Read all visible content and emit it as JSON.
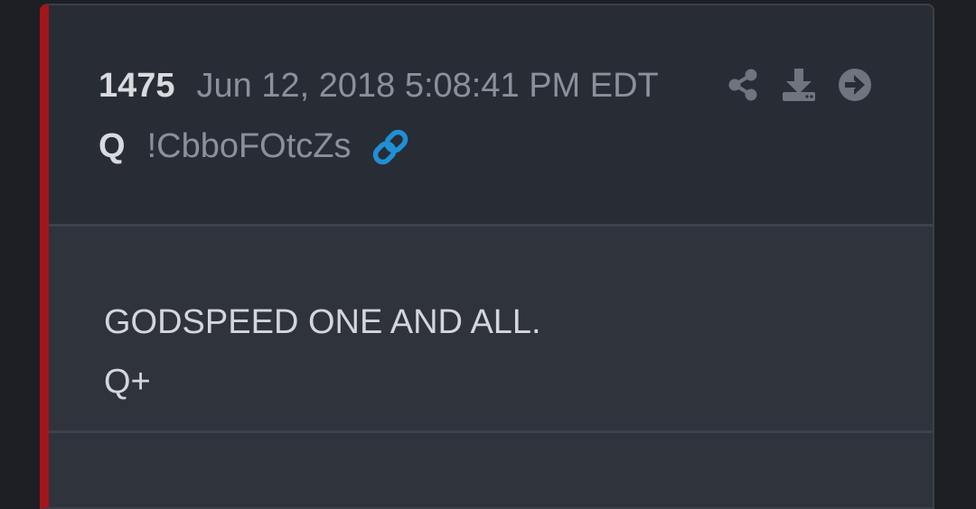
{
  "post": {
    "number": "1475",
    "date": "Jun 12, 2018 5:08:41 PM EDT",
    "author": "Q",
    "tripcode": "!CbboFOtcZs",
    "body_lines": [
      "GODSPEED ONE AND ALL.",
      "Q+"
    ]
  },
  "icons": {
    "link": "link-icon",
    "share": "share-icon",
    "download": "download-icon",
    "goto": "arrow-right-circle-icon"
  },
  "colors": {
    "background": "#1d1f24",
    "post_header": "#282c34",
    "post_body": "#2f333c",
    "accent_bar": "#a3161c",
    "link_blue": "#1f8fd6",
    "muted_text": "#8b909a",
    "bright_text": "#d8dade"
  }
}
